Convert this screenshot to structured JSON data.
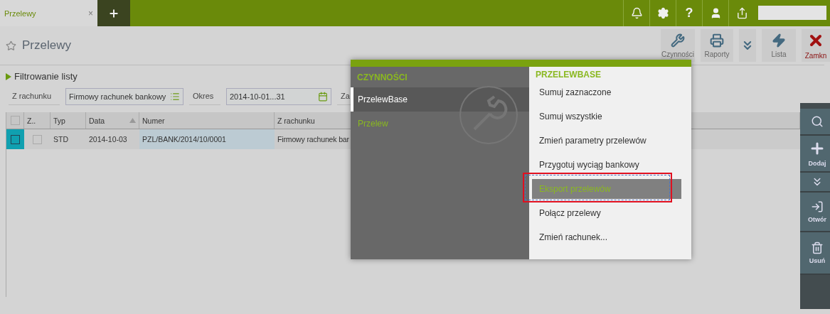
{
  "tabs": [
    {
      "label": "Przelewy",
      "selected": true
    }
  ],
  "tab_close": "×",
  "top_icons": [
    {
      "kind": "bell"
    },
    {
      "kind": "gear"
    },
    {
      "kind": "help",
      "label": "?"
    },
    {
      "kind": "user"
    },
    {
      "kind": "exit"
    }
  ],
  "page": {
    "title": "Przelewy",
    "favorite": false
  },
  "toolbar": [
    {
      "kind": "wrench",
      "label": "Czynności"
    },
    {
      "kind": "printer",
      "label": "Raporty"
    },
    {
      "kind": "more"
    },
    {
      "kind": "lightning",
      "label": "Lista"
    },
    {
      "kind": "close",
      "label": "Zamkn"
    }
  ],
  "filter": {
    "title": "Filtrowanie listy",
    "expanded": false,
    "fields": [
      {
        "label": "Z rachunku",
        "value": "Firmowy rachunek bankowy",
        "kind": "list"
      },
      {
        "label": "Okres",
        "value": "2014-10-01...31",
        "kind": "date"
      },
      {
        "label": "Za",
        "kind": "cut"
      }
    ]
  },
  "table": {
    "all_checked": false,
    "columns": [
      "",
      "Z..",
      "Typ",
      "Data",
      "Numer",
      "Z rachunku"
    ],
    "rows": [
      {
        "selected": true,
        "checked": false,
        "cells": [
          "",
          "",
          "STD",
          "2014-10-03",
          "PZL/BANK/2014/10/0001",
          "Firmowy rachunek bar"
        ]
      }
    ]
  },
  "side_actions": [
    {
      "kind": "search"
    },
    {
      "kind": "add",
      "label": "Dodaj"
    },
    {
      "kind": "more"
    },
    {
      "kind": "open",
      "label": "Otwór"
    },
    {
      "kind": "delete",
      "label": "Usuń"
    }
  ],
  "menu": {
    "left_title": "CZYNNOŚCI",
    "left_items": [
      {
        "label": "PrzelewBase",
        "selected": true
      },
      {
        "label": "Przelew",
        "selected": false
      }
    ],
    "right_title": "PRZELEWBASE",
    "right_items": [
      {
        "label": "Sumuj zaznaczone",
        "selected": false
      },
      {
        "label": "Sumuj wszystkie",
        "selected": false
      },
      {
        "label": "Zmień parametry przelewów",
        "selected": false
      },
      {
        "label": "Przygotuj wyciąg bankowy",
        "selected": false
      },
      {
        "label": "Eksport przelewów",
        "selected": true
      },
      {
        "label": "Połącz przelewy",
        "selected": false
      },
      {
        "label": "Zmień rachunek...",
        "selected": false
      }
    ]
  }
}
